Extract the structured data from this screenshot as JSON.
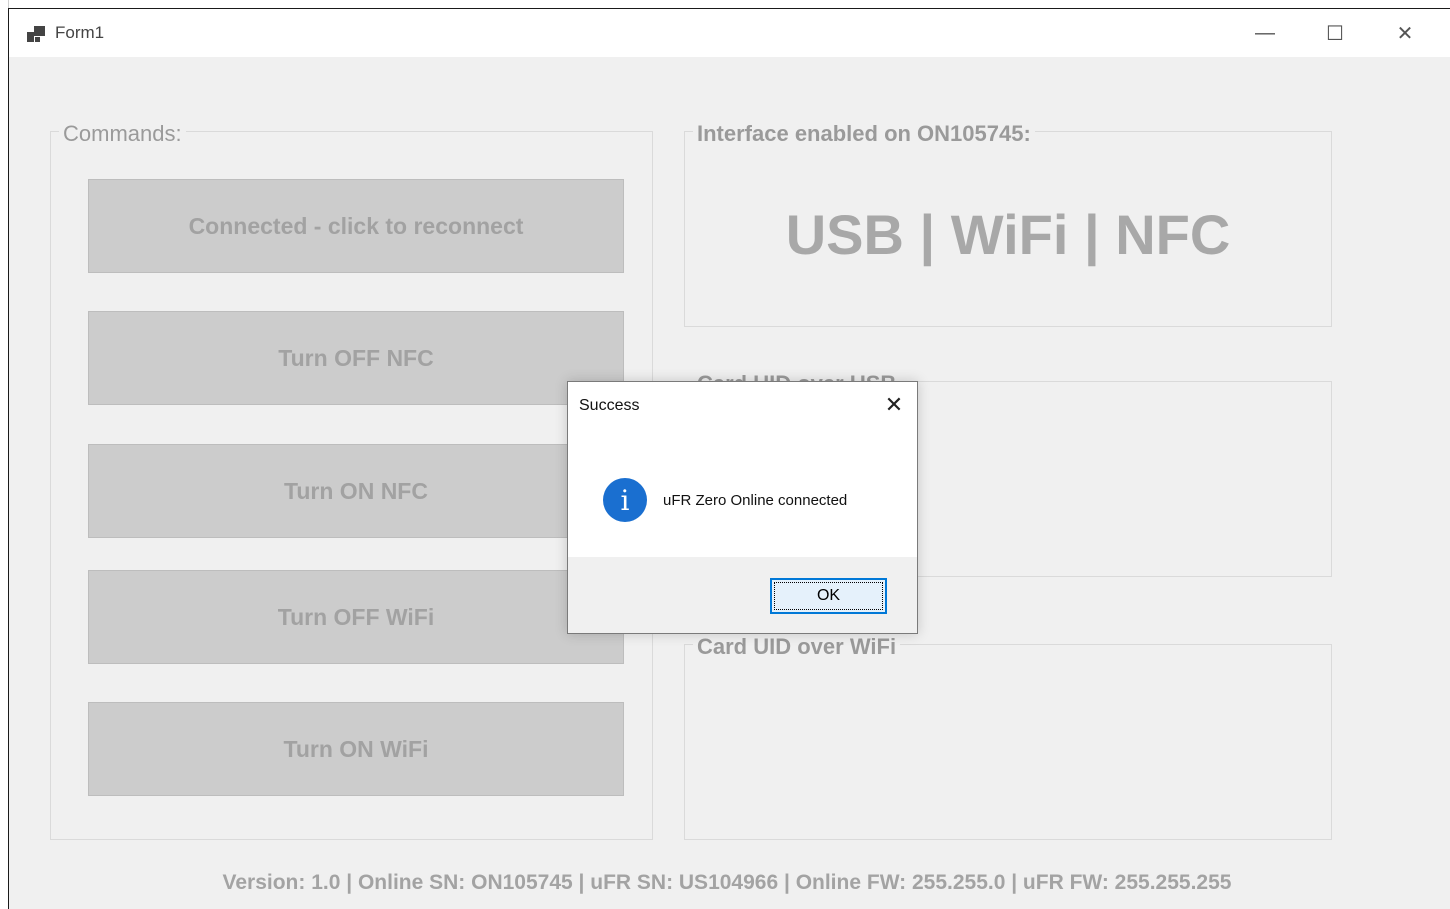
{
  "window": {
    "title": "Form1",
    "minimize_glyph": "—",
    "maximize_glyph": "☐",
    "close_glyph": "✕"
  },
  "commands": {
    "label": "Commands:",
    "buttons": [
      "Connected - click to reconnect",
      "Turn OFF NFC",
      "Turn ON NFC",
      "Turn OFF WiFi",
      "Turn ON WiFi"
    ]
  },
  "interface": {
    "label": "Interface enabled on ON105745:",
    "value": "USB | WiFi | NFC"
  },
  "card_usb": {
    "label": "Card UID over USB",
    "value": ""
  },
  "card_wifi": {
    "label": "Card UID over WiFi",
    "value": ""
  },
  "footer": {
    "text": "Version: 1.0 | Online SN: ON105745 | uFR SN: US104966 | Online FW: 255.255.0 | uFR FW: 255.255.255"
  },
  "dialog": {
    "title": "Success",
    "message": "uFR Zero Online connected",
    "ok_label": "OK",
    "icon": "info-icon",
    "close_glyph": "✕"
  },
  "colors": {
    "info_icon": "#1a6fd0",
    "ok_border": "#0078d7",
    "disabled_text": "#a2a2a2"
  }
}
